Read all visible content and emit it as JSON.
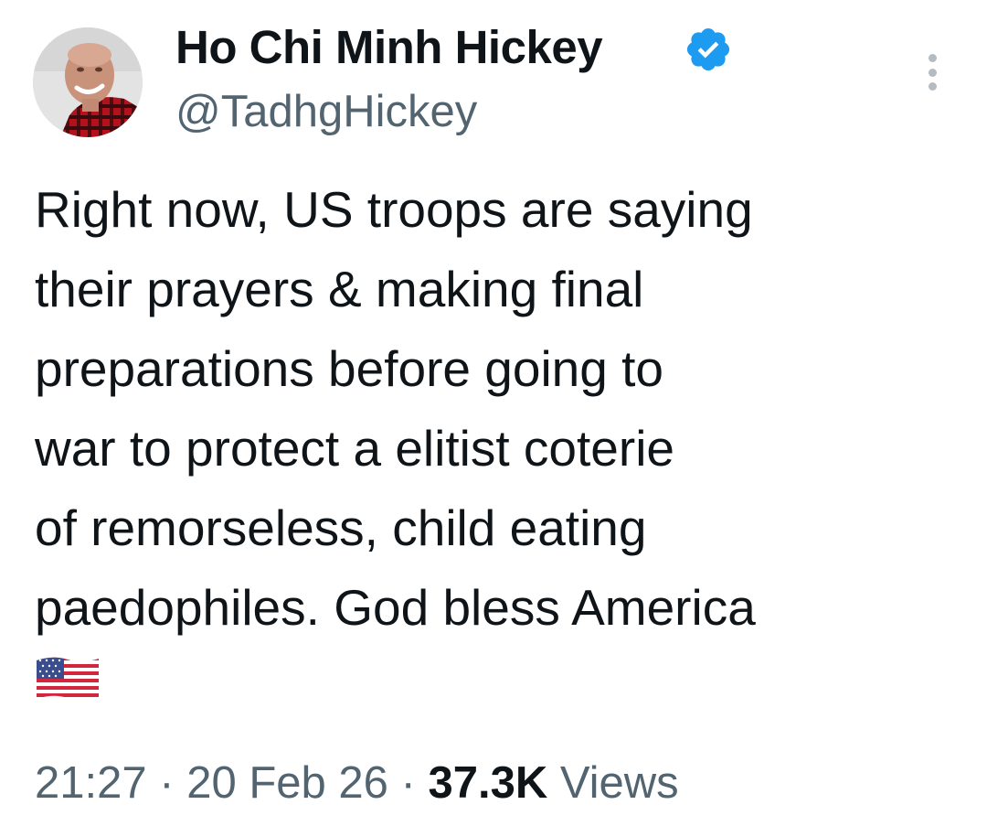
{
  "author": {
    "display_name": "Ho Chi Minh Hickey",
    "handle": "@TadhgHickey",
    "verified": true,
    "verified_color": "#1d9bf0",
    "avatar_icon": "profile-photo"
  },
  "tweet": {
    "lines": [
      "Right now, US troops are saying",
      "their prayers & making final",
      "preparations before going to",
      "war to protect a elitist coterie",
      "of remorseless, child eating",
      "paedophiles. God bless America"
    ],
    "emoji": "us-flag-emoji"
  },
  "meta": {
    "time": "21:27",
    "separator": "·",
    "date": "20 Feb 26",
    "views_count": "37.3K",
    "views_label": "Views"
  },
  "colors": {
    "text_primary": "#0f1419",
    "text_secondary": "#536471",
    "background": "#ffffff"
  }
}
